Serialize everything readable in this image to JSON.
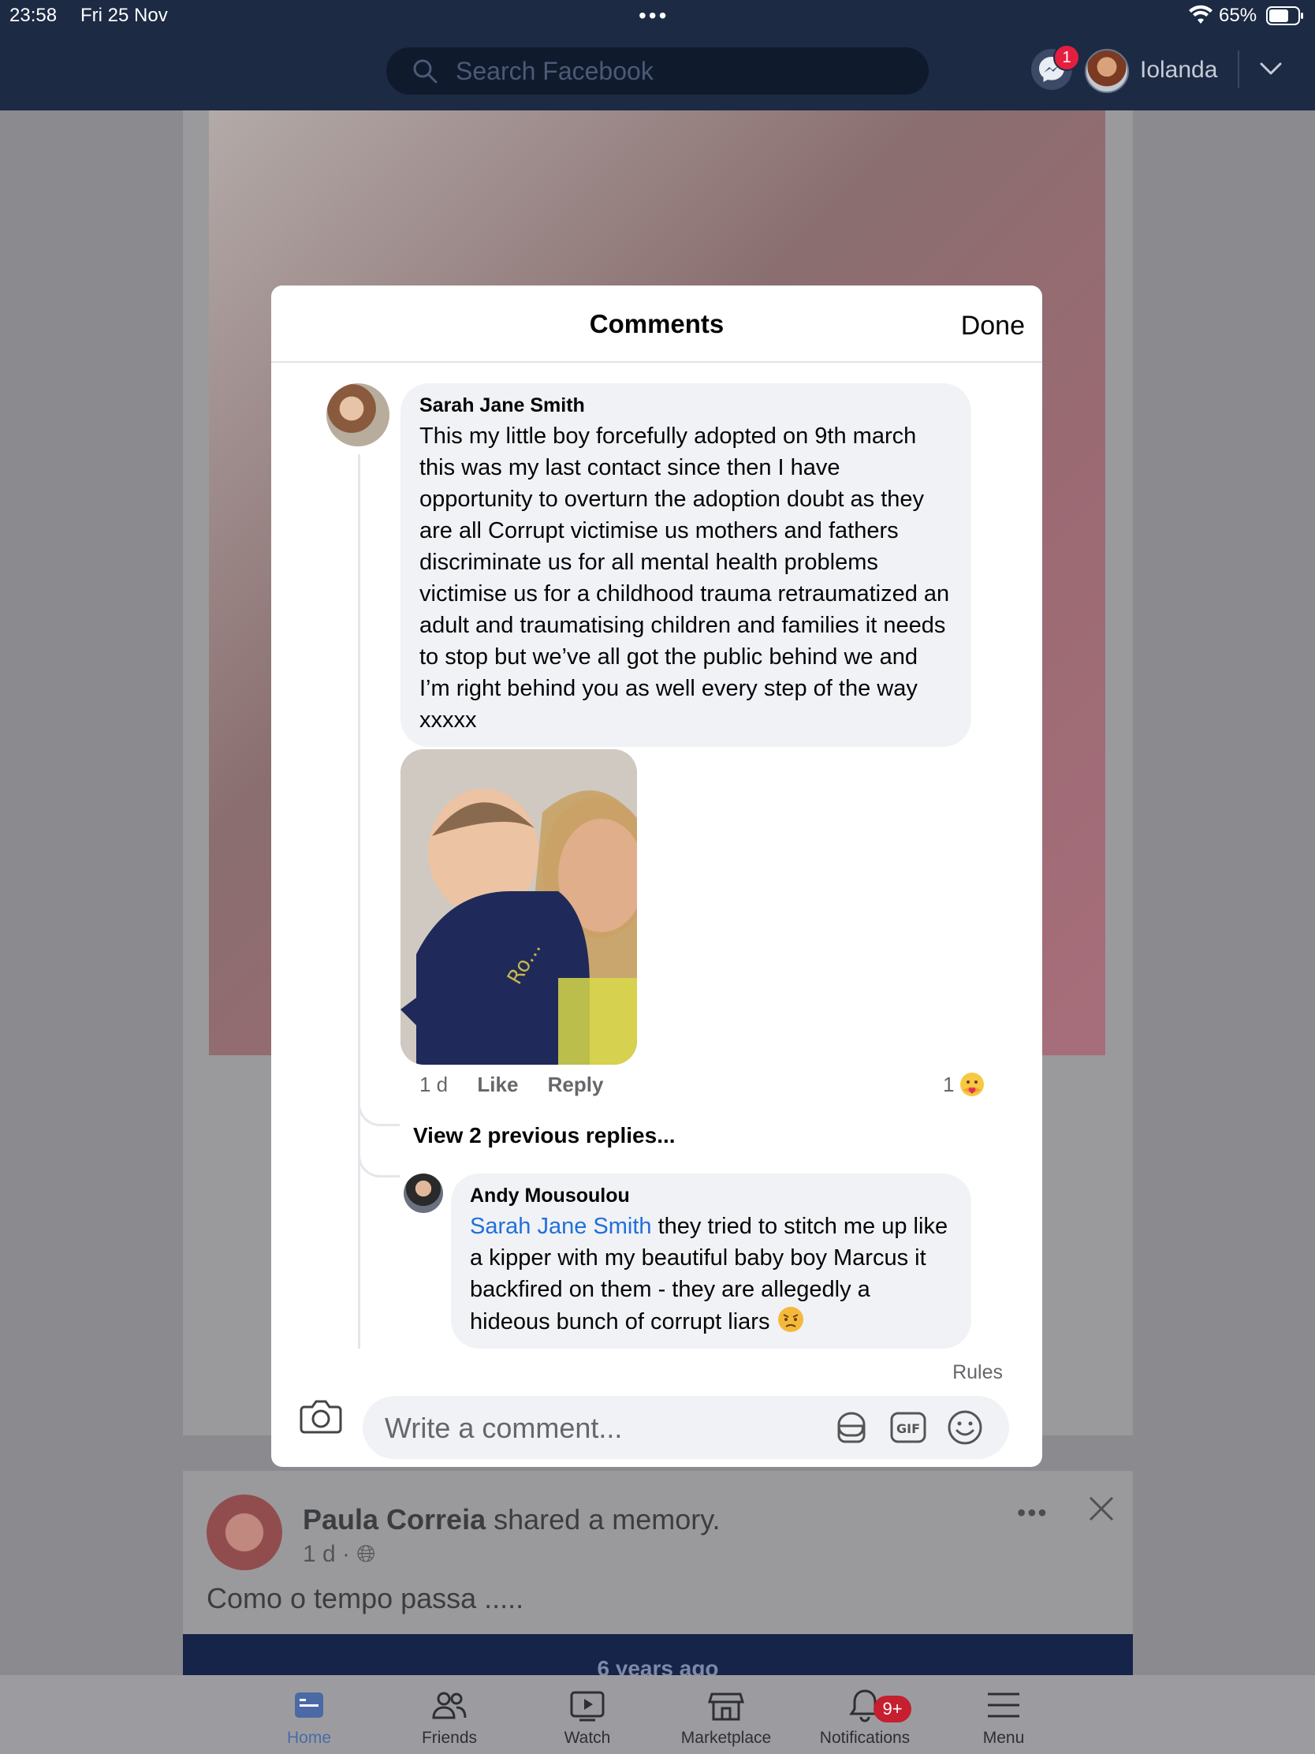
{
  "status_bar": {
    "time": "23:58",
    "date": "Fri 25 Nov",
    "battery": "65%"
  },
  "header": {
    "search_placeholder": "Search Facebook",
    "messenger_badge": "1",
    "user_name": "Iolanda"
  },
  "modal": {
    "title": "Comments",
    "done_label": "Done",
    "comment": {
      "author": "Sarah Jane Smith",
      "text": "This my little boy forcefully adopted on 9th march this was my last contact since then I have opportunity to overturn the adoption doubt as they are all Corrupt victimise us mothers and fathers discriminate us for all mental health problems victimise us for a childhood trauma retraumatized an adult and traumatising children and families it needs to stop but we’ve all got the public behind we and I’m right behind you as well every step of the way xxxxx",
      "time": "1 d",
      "like_label": "Like",
      "reply_label": "Reply",
      "reaction_count": "1",
      "reaction_icon": "care-emoji"
    },
    "view_previous_replies": "View 2 previous replies...",
    "reply": {
      "author": "Andy Mousoulou",
      "mention": "Sarah Jane Smith",
      "text": " they tried to stitch me up like a kipper with my beautiful baby boy Marcus it backfired on them - they are allegedly a hideous bunch of corrupt liars",
      "emoji": "angry-emoji"
    },
    "rules_label": "Rules",
    "composer_placeholder": "Write a comment..."
  },
  "feed": {
    "post2_author": "Paula Correia",
    "post2_action": " shared a memory.",
    "post2_time": "1 d ·",
    "post2_text": "Como o tempo passa .....",
    "memory_banner": "6 years ago"
  },
  "tabs": [
    {
      "label": "Home",
      "icon": "home-icon"
    },
    {
      "label": "Friends",
      "icon": "friends-icon"
    },
    {
      "label": "Watch",
      "icon": "watch-icon"
    },
    {
      "label": "Marketplace",
      "icon": "marketplace-icon"
    },
    {
      "label": "Notifications",
      "icon": "bell-icon",
      "badge": "9+"
    },
    {
      "label": "Menu",
      "icon": "menu-icon"
    }
  ],
  "colors": {
    "header_bg": "#1c2a44",
    "link": "#216fdb",
    "bubble": "#f0f2f5",
    "badge": "#e41e3f"
  }
}
